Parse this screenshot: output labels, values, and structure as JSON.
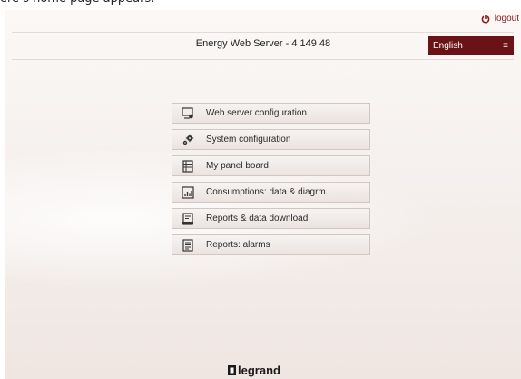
{
  "caption": "ere s home page appears.",
  "header": {
    "logout_label": "logout",
    "title": "Energy Web Server - 4 149 48",
    "language": "English"
  },
  "menu": {
    "items": [
      {
        "label": "Web server configuration",
        "icon": "web-config-icon"
      },
      {
        "label": "System configuration",
        "icon": "gears-icon"
      },
      {
        "label": "My panel board",
        "icon": "panel-board-icon"
      },
      {
        "label": "Consumptions: data & diagrm.",
        "icon": "chart-icon"
      },
      {
        "label": "Reports & data download",
        "icon": "download-report-icon"
      },
      {
        "label": "Reports: alarms",
        "icon": "alarm-report-icon"
      }
    ]
  },
  "footer": {
    "brand": "legrand"
  },
  "colors": {
    "accent": "#6b1216",
    "logout": "#8a1a1a"
  }
}
